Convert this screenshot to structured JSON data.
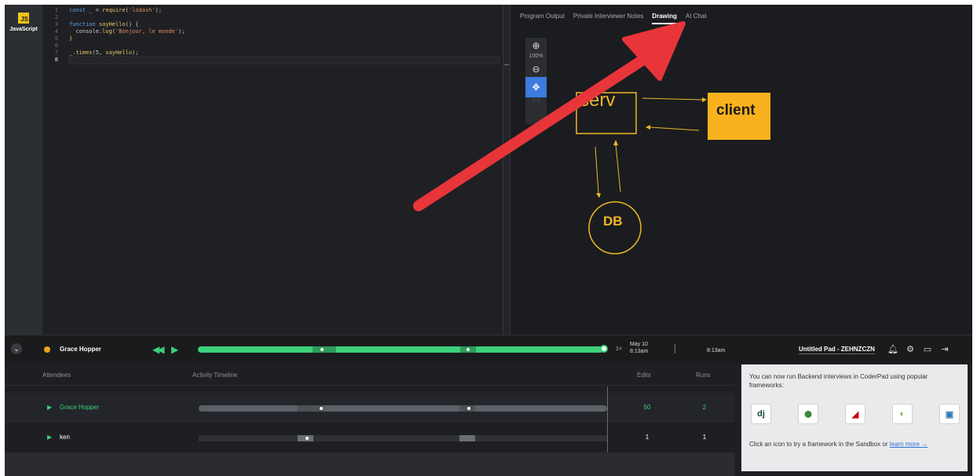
{
  "language": {
    "badge": "JS",
    "label": "JavaScript"
  },
  "editor": {
    "line_numbers": [
      "1",
      "2",
      "3",
      "4",
      "5",
      "6",
      "7",
      "8"
    ],
    "lines": [
      {
        "tokens": [
          {
            "t": "const",
            "c": "kw"
          },
          {
            "t": " _ = ",
            "c": "id"
          },
          {
            "t": "require",
            "c": "fn"
          },
          {
            "t": "(",
            "c": "id"
          },
          {
            "t": "'lodash'",
            "c": "str"
          },
          {
            "t": ");",
            "c": "id"
          }
        ]
      },
      {
        "tokens": []
      },
      {
        "tokens": [
          {
            "t": "function",
            "c": "kw"
          },
          {
            "t": " ",
            "c": "id"
          },
          {
            "t": "sayHello",
            "c": "fn"
          },
          {
            "t": "() {",
            "c": "id"
          }
        ]
      },
      {
        "tokens": [
          {
            "t": "  console.",
            "c": "id"
          },
          {
            "t": "log",
            "c": "fn"
          },
          {
            "t": "(",
            "c": "id"
          },
          {
            "t": "'Bonjour, le monde'",
            "c": "str"
          },
          {
            "t": ");",
            "c": "id"
          }
        ]
      },
      {
        "tokens": [
          {
            "t": "}",
            "c": "fn"
          }
        ]
      },
      {
        "tokens": []
      },
      {
        "tokens": [
          {
            "t": "_.",
            "c": "id"
          },
          {
            "t": "times",
            "c": "fn"
          },
          {
            "t": "(5, ",
            "c": "id"
          },
          {
            "t": "sayHello",
            "c": "fn"
          },
          {
            "t": ");",
            "c": "id"
          }
        ]
      },
      {
        "tokens": []
      }
    ]
  },
  "tabs": [
    {
      "label": "Program Output",
      "active": false
    },
    {
      "label": "Private Interviewer Notes",
      "active": false
    },
    {
      "label": "Drawing",
      "active": true
    },
    {
      "label": "AI Chat",
      "active": false
    }
  ],
  "drawing": {
    "zoom": "100%",
    "labels": {
      "server": "serv",
      "client": "client",
      "db": "DB"
    },
    "stroke_color": "#f0b728",
    "client_fill": "#f9b21d"
  },
  "player": {
    "user": "Grace Hopper",
    "speed": "1×",
    "date": "May 10",
    "time_start": "8:13am",
    "time_end": "8:13am",
    "pad_name": "Untitled Pad - ZEHNZCZN",
    "progress": 1.0
  },
  "activity": {
    "headers": {
      "attendees": "Attendees",
      "timeline": "Activity Timeline",
      "edits": "Edits",
      "runs": "Runs"
    },
    "rows": [
      {
        "name": "Grace Hopper",
        "edits": "50",
        "runs": "2",
        "color": "#3dd07a"
      },
      {
        "name": "ken",
        "edits": "1",
        "runs": "1",
        "color": "#ffffff"
      }
    ]
  },
  "promo": {
    "text": "You can now run Backend interviews in CoderPad using popular frameworks:",
    "footer_text": "Click an icon to try a framework in the Sandbox or ",
    "link": "learn more →",
    "frameworks": [
      {
        "name": "django-icon",
        "glyph": "dj"
      },
      {
        "name": "nodejs-icon",
        "glyph": "⬢"
      },
      {
        "name": "rails-icon",
        "glyph": "◢"
      },
      {
        "name": "spring-icon",
        "glyph": "◐"
      },
      {
        "name": "flask-icon",
        "glyph": "▣"
      }
    ]
  },
  "colors": {
    "accent_green": "#3dd07a",
    "arrow_red": "#e8353a",
    "user_dot": "#f2a31b"
  }
}
